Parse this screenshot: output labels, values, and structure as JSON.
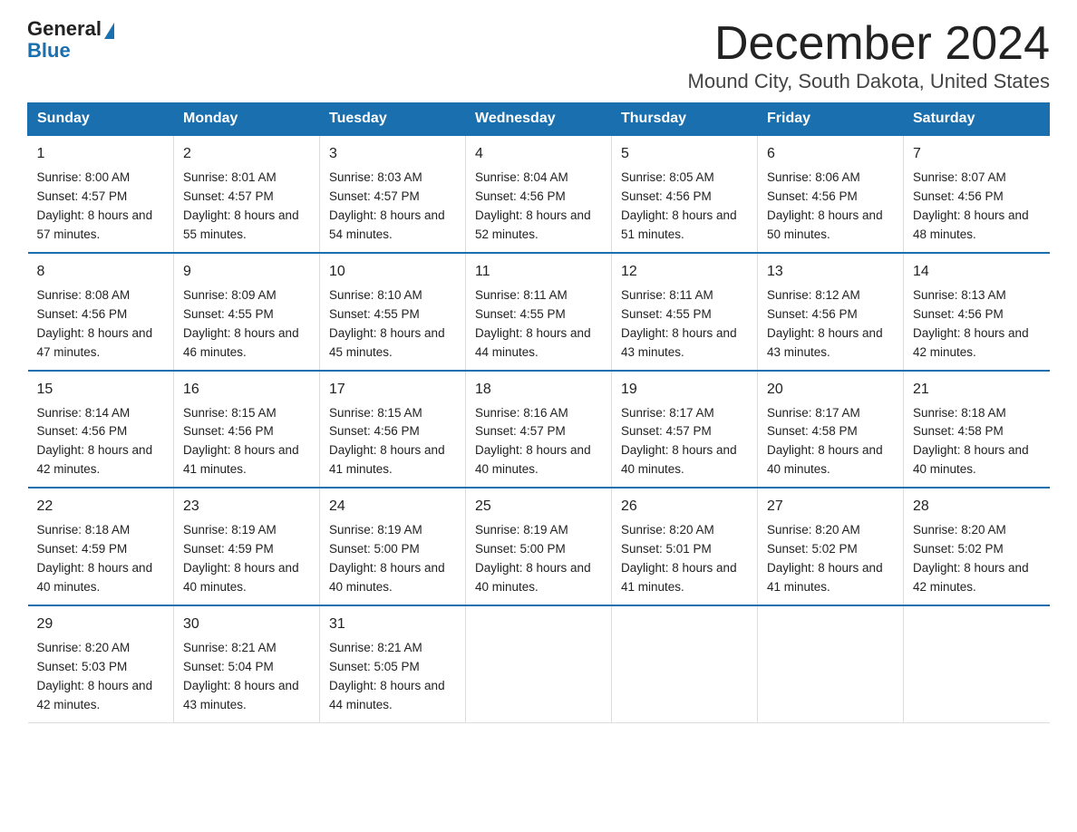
{
  "header": {
    "logo_general": "General",
    "logo_blue": "Blue",
    "month_title": "December 2024",
    "location": "Mound City, South Dakota, United States"
  },
  "weekdays": [
    "Sunday",
    "Monday",
    "Tuesday",
    "Wednesday",
    "Thursday",
    "Friday",
    "Saturday"
  ],
  "weeks": [
    [
      {
        "day": "1",
        "sunrise": "8:00 AM",
        "sunset": "4:57 PM",
        "daylight": "8 hours and 57 minutes."
      },
      {
        "day": "2",
        "sunrise": "8:01 AM",
        "sunset": "4:57 PM",
        "daylight": "8 hours and 55 minutes."
      },
      {
        "day": "3",
        "sunrise": "8:03 AM",
        "sunset": "4:57 PM",
        "daylight": "8 hours and 54 minutes."
      },
      {
        "day": "4",
        "sunrise": "8:04 AM",
        "sunset": "4:56 PM",
        "daylight": "8 hours and 52 minutes."
      },
      {
        "day": "5",
        "sunrise": "8:05 AM",
        "sunset": "4:56 PM",
        "daylight": "8 hours and 51 minutes."
      },
      {
        "day": "6",
        "sunrise": "8:06 AM",
        "sunset": "4:56 PM",
        "daylight": "8 hours and 50 minutes."
      },
      {
        "day": "7",
        "sunrise": "8:07 AM",
        "sunset": "4:56 PM",
        "daylight": "8 hours and 48 minutes."
      }
    ],
    [
      {
        "day": "8",
        "sunrise": "8:08 AM",
        "sunset": "4:56 PM",
        "daylight": "8 hours and 47 minutes."
      },
      {
        "day": "9",
        "sunrise": "8:09 AM",
        "sunset": "4:55 PM",
        "daylight": "8 hours and 46 minutes."
      },
      {
        "day": "10",
        "sunrise": "8:10 AM",
        "sunset": "4:55 PM",
        "daylight": "8 hours and 45 minutes."
      },
      {
        "day": "11",
        "sunrise": "8:11 AM",
        "sunset": "4:55 PM",
        "daylight": "8 hours and 44 minutes."
      },
      {
        "day": "12",
        "sunrise": "8:11 AM",
        "sunset": "4:55 PM",
        "daylight": "8 hours and 43 minutes."
      },
      {
        "day": "13",
        "sunrise": "8:12 AM",
        "sunset": "4:56 PM",
        "daylight": "8 hours and 43 minutes."
      },
      {
        "day": "14",
        "sunrise": "8:13 AM",
        "sunset": "4:56 PM",
        "daylight": "8 hours and 42 minutes."
      }
    ],
    [
      {
        "day": "15",
        "sunrise": "8:14 AM",
        "sunset": "4:56 PM",
        "daylight": "8 hours and 42 minutes."
      },
      {
        "day": "16",
        "sunrise": "8:15 AM",
        "sunset": "4:56 PM",
        "daylight": "8 hours and 41 minutes."
      },
      {
        "day": "17",
        "sunrise": "8:15 AM",
        "sunset": "4:56 PM",
        "daylight": "8 hours and 41 minutes."
      },
      {
        "day": "18",
        "sunrise": "8:16 AM",
        "sunset": "4:57 PM",
        "daylight": "8 hours and 40 minutes."
      },
      {
        "day": "19",
        "sunrise": "8:17 AM",
        "sunset": "4:57 PM",
        "daylight": "8 hours and 40 minutes."
      },
      {
        "day": "20",
        "sunrise": "8:17 AM",
        "sunset": "4:58 PM",
        "daylight": "8 hours and 40 minutes."
      },
      {
        "day": "21",
        "sunrise": "8:18 AM",
        "sunset": "4:58 PM",
        "daylight": "8 hours and 40 minutes."
      }
    ],
    [
      {
        "day": "22",
        "sunrise": "8:18 AM",
        "sunset": "4:59 PM",
        "daylight": "8 hours and 40 minutes."
      },
      {
        "day": "23",
        "sunrise": "8:19 AM",
        "sunset": "4:59 PM",
        "daylight": "8 hours and 40 minutes."
      },
      {
        "day": "24",
        "sunrise": "8:19 AM",
        "sunset": "5:00 PM",
        "daylight": "8 hours and 40 minutes."
      },
      {
        "day": "25",
        "sunrise": "8:19 AM",
        "sunset": "5:00 PM",
        "daylight": "8 hours and 40 minutes."
      },
      {
        "day": "26",
        "sunrise": "8:20 AM",
        "sunset": "5:01 PM",
        "daylight": "8 hours and 41 minutes."
      },
      {
        "day": "27",
        "sunrise": "8:20 AM",
        "sunset": "5:02 PM",
        "daylight": "8 hours and 41 minutes."
      },
      {
        "day": "28",
        "sunrise": "8:20 AM",
        "sunset": "5:02 PM",
        "daylight": "8 hours and 42 minutes."
      }
    ],
    [
      {
        "day": "29",
        "sunrise": "8:20 AM",
        "sunset": "5:03 PM",
        "daylight": "8 hours and 42 minutes."
      },
      {
        "day": "30",
        "sunrise": "8:21 AM",
        "sunset": "5:04 PM",
        "daylight": "8 hours and 43 minutes."
      },
      {
        "day": "31",
        "sunrise": "8:21 AM",
        "sunset": "5:05 PM",
        "daylight": "8 hours and 44 minutes."
      },
      null,
      null,
      null,
      null
    ]
  ]
}
